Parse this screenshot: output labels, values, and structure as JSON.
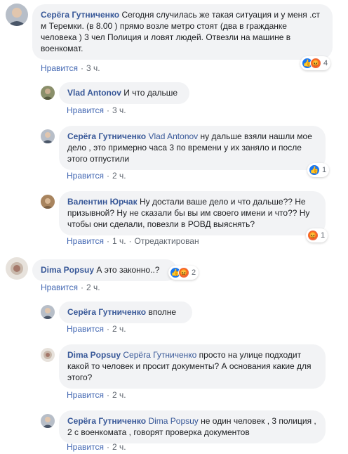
{
  "actions": {
    "like": "Нравится",
    "edited": "Отредактирован"
  },
  "comments": [
    {
      "author": "Серёга Гутниченко",
      "text": "Сегодня случилась же такая ситуация и у меня .ст м Теремки. (в 8.00 ) прямо возле метро стоят (два в гражданке человека ) 3 чел Полиция и ловят людей. Отвезли на машине в военкомат.",
      "time": "3 ч.",
      "reaction_count": "4"
    },
    {
      "author": "Vlad Antonov",
      "text": "И что дальше",
      "time": "3 ч."
    },
    {
      "author": "Серёга Гутниченко",
      "mention": "Vlad Antonov",
      "text": "ну дальше взяли нашли мое дело , это примерно часа 3 по времени у их заняло и после этого отпустили",
      "time": "2 ч.",
      "reaction_count": "1"
    },
    {
      "author": "Валентин Юрчак",
      "text": "Ну достали ваше дело и что дальше?? Не призывной? Ну не сказали бы вы им своего имени и что?? Ну чтобы они сделали, повезли в РОВД выяснять?",
      "time": "1 ч.",
      "reaction_count": "1"
    },
    {
      "author": "Dima Popsuy",
      "text": "А это законно..?",
      "time": "2 ч.",
      "reaction_count": "2"
    },
    {
      "author": "Серёга Гутниченко",
      "text": "вполне",
      "time": "2 ч."
    },
    {
      "author": "Dima Popsuy",
      "mention": "Серёга Гутниченко",
      "text": "просто на улице подходит какой то человек и просит документы? А основания какие для этого?",
      "time": "2 ч."
    },
    {
      "author": "Серёга Гутниченко",
      "mention": "Dima Popsuy",
      "text": "не один человек , 3 полиция , 2 с военкомата , говорят проверка документов",
      "time": "2 ч."
    }
  ]
}
